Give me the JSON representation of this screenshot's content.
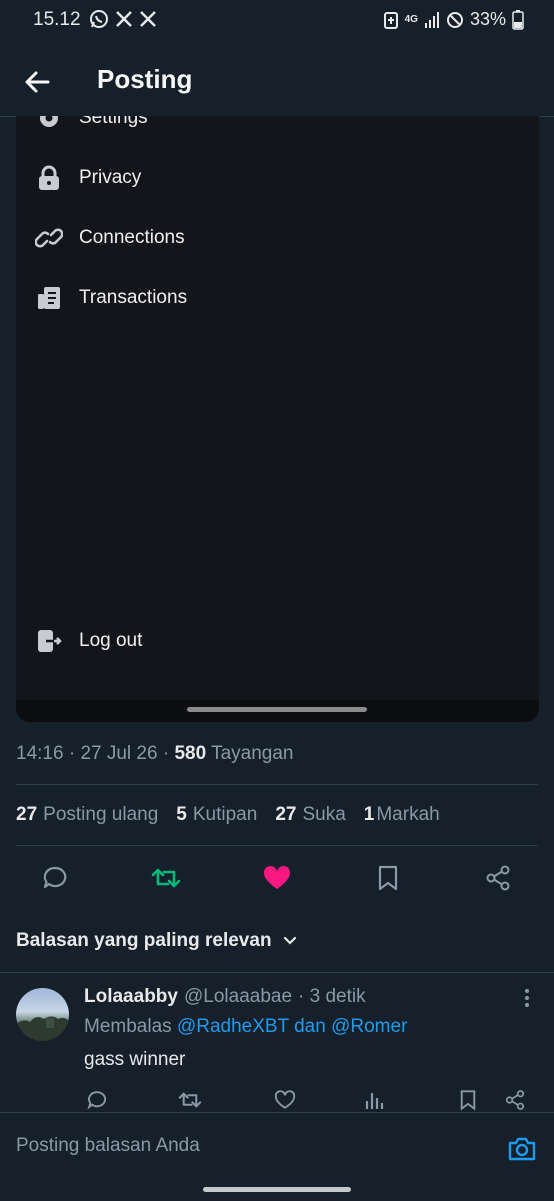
{
  "status_bar": {
    "time": "15.12",
    "battery": "33%",
    "network": "4G"
  },
  "header": {
    "title": "Posting"
  },
  "embedded_menu": {
    "items": [
      {
        "label": "Settings",
        "icon": "gear-icon"
      },
      {
        "label": "Privacy",
        "icon": "lock-icon"
      },
      {
        "label": "Connections",
        "icon": "link-icon"
      },
      {
        "label": "Transactions",
        "icon": "transactions-icon"
      }
    ],
    "logout": {
      "label": "Log out",
      "icon": "logout-icon"
    }
  },
  "post_meta": {
    "time": "14:16",
    "date": "27 Jul 26",
    "views_count": "580",
    "views_label": "Tayangan"
  },
  "stats": {
    "reposts_count": "27",
    "reposts_label": "Posting ulang",
    "quotes_count": "5",
    "quotes_label": "Kutipan",
    "likes_count": "27",
    "likes_label": "Suka",
    "bookmarks_count": "1",
    "bookmarks_label": "Markah"
  },
  "colors": {
    "accent": "#1d9bf0",
    "repost_active": "#00ba7c",
    "like_active": "#f91880",
    "background": "#15202b"
  },
  "sort": {
    "label": "Balasan yang paling relevan"
  },
  "reply": {
    "name": "Lolaaabby",
    "handle": "@Lolaaabae",
    "time": "· 3 detik",
    "replying_prefix": "Membalas",
    "replying_user1": "@RadheXBT",
    "replying_conj": "dan",
    "replying_user2": "@Romer",
    "text": "gass winner"
  },
  "compose": {
    "placeholder": "Posting balasan Anda"
  }
}
